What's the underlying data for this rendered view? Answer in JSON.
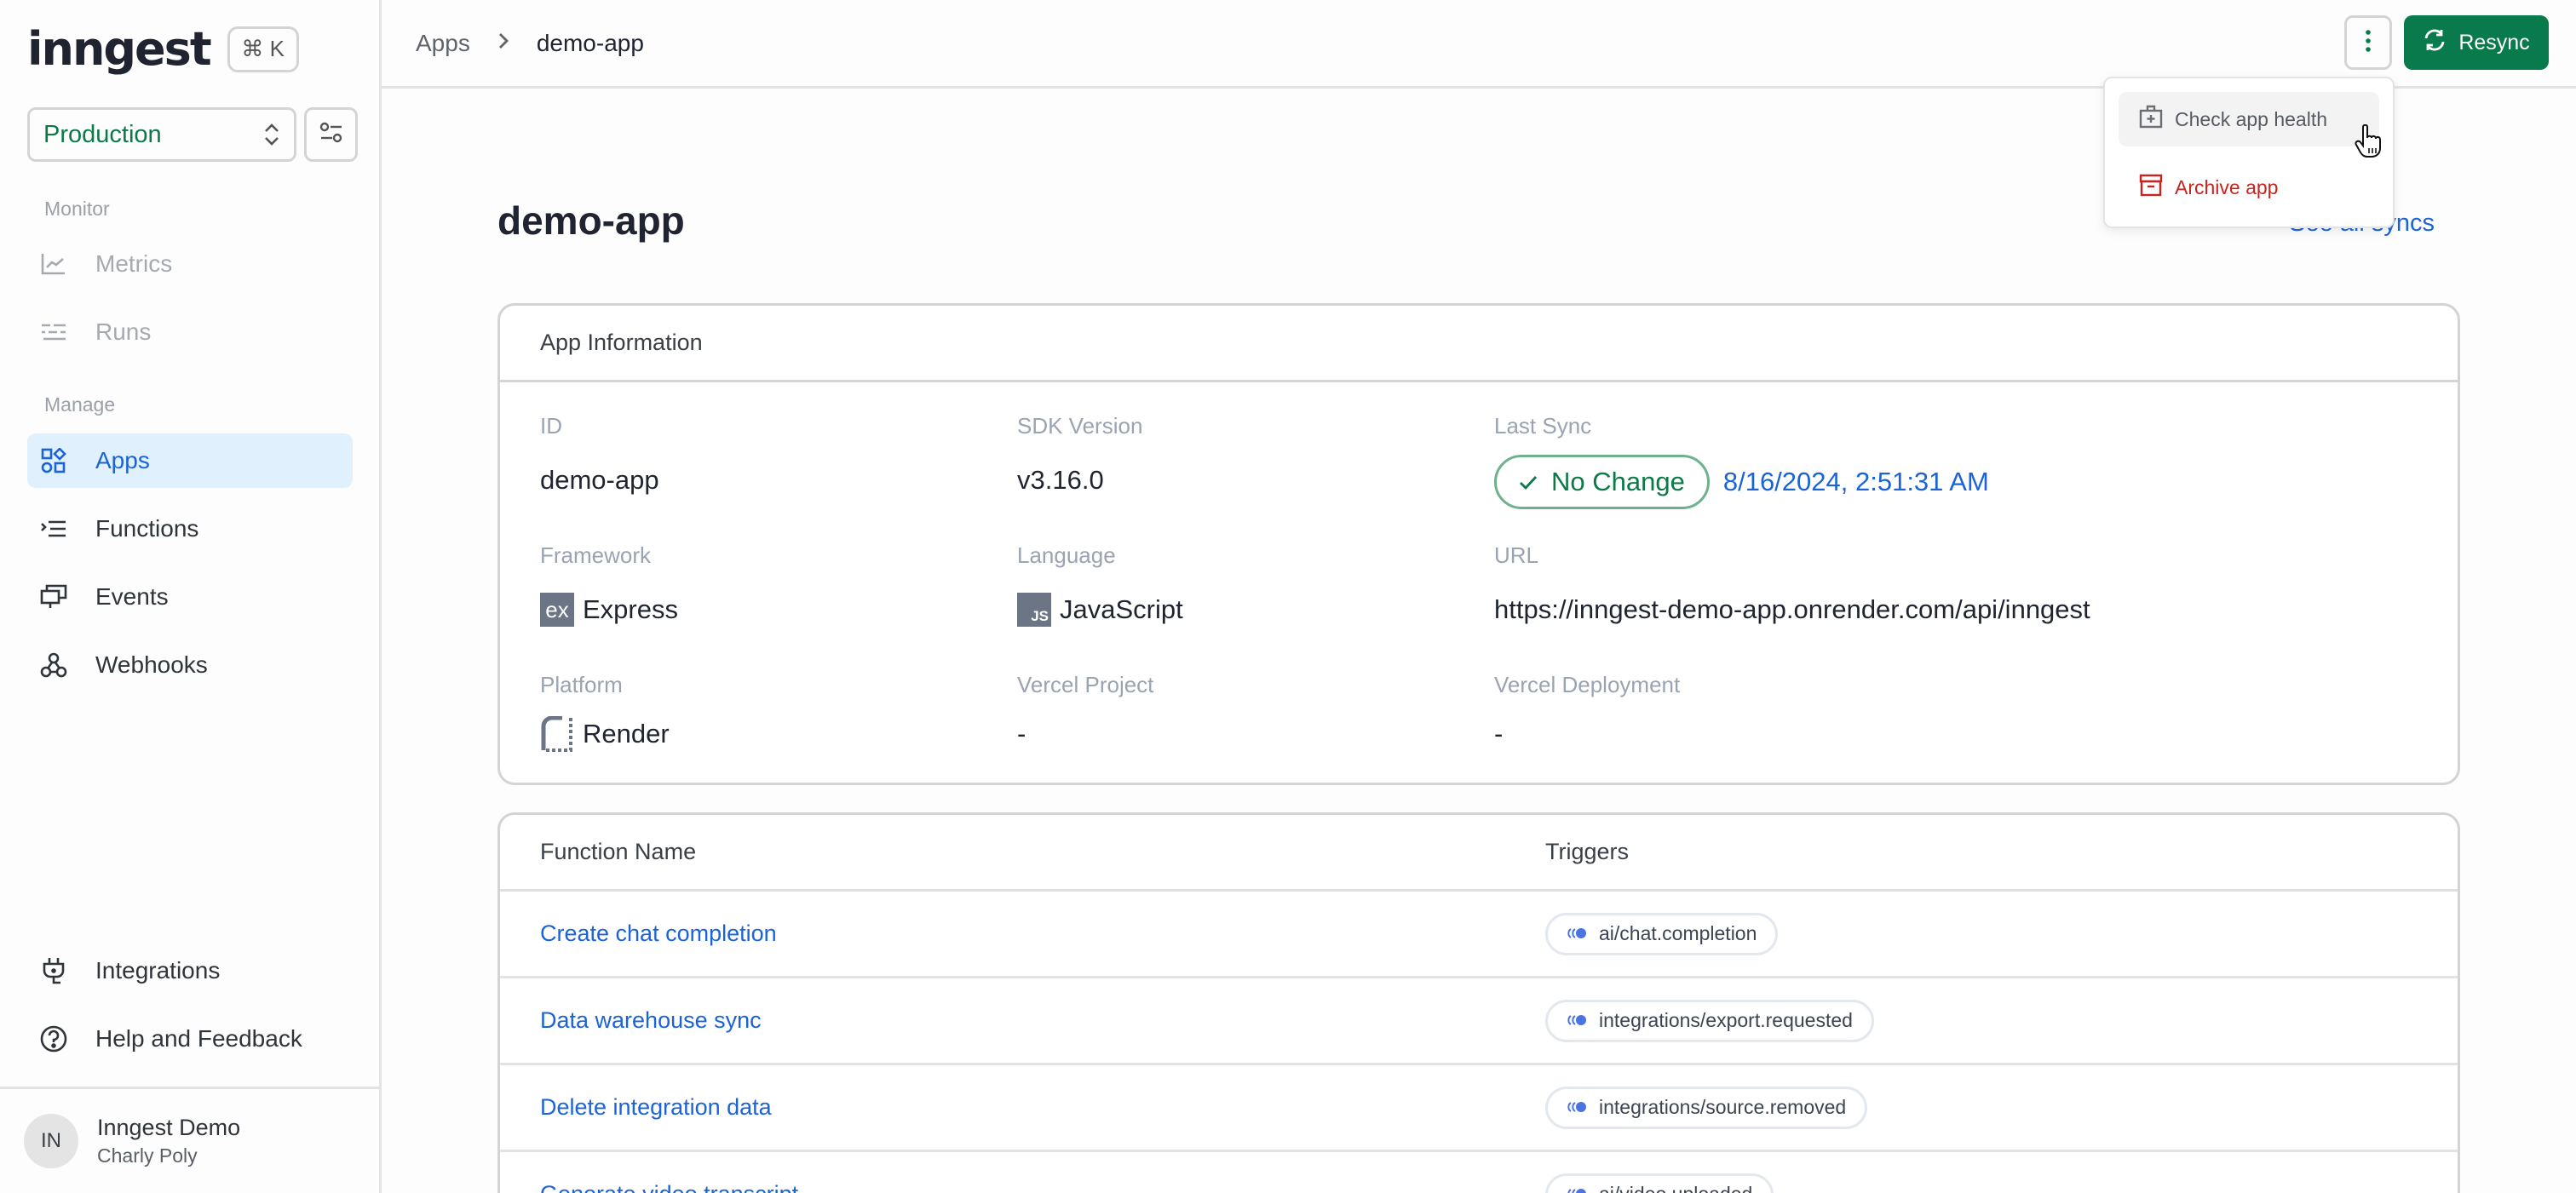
{
  "sidebar": {
    "logo": "inngest",
    "shortcut": "⌘ K",
    "environment": "Production",
    "sections": [
      {
        "label": "Monitor",
        "items": [
          {
            "label": "Metrics",
            "icon": "chart-line-icon",
            "state": "disabled"
          },
          {
            "label": "Runs",
            "icon": "runs-list-icon",
            "state": "disabled"
          }
        ]
      },
      {
        "label": "Manage",
        "items": [
          {
            "label": "Apps",
            "icon": "apps-grid-icon",
            "state": "active"
          },
          {
            "label": "Functions",
            "icon": "functions-icon",
            "state": "normal"
          },
          {
            "label": "Events",
            "icon": "events-icon",
            "state": "normal"
          },
          {
            "label": "Webhooks",
            "icon": "webhook-icon",
            "state": "normal"
          }
        ]
      }
    ],
    "bottom_items": [
      {
        "label": "Integrations",
        "icon": "plug-icon"
      },
      {
        "label": "Help and Feedback",
        "icon": "help-circle-icon"
      }
    ],
    "user": {
      "initials": "IN",
      "org": "Inngest Demo",
      "name": "Charly Poly"
    }
  },
  "topbar": {
    "breadcrumb": [
      "Apps",
      "demo-app"
    ],
    "resync_label": "Resync"
  },
  "dropdown": {
    "items": [
      {
        "label": "Check app health",
        "icon": "first-aid-kit-icon",
        "variant": "default",
        "hovered": true
      },
      {
        "label": "Archive app",
        "icon": "archive-icon",
        "variant": "danger"
      }
    ]
  },
  "page": {
    "title": "demo-app",
    "see_all_syncs": "See all syncs"
  },
  "app_info": {
    "header": "App Information",
    "fields": {
      "id": {
        "label": "ID",
        "value": "demo-app"
      },
      "sdk_version": {
        "label": "SDK Version",
        "value": "v3.16.0"
      },
      "last_sync": {
        "label": "Last Sync",
        "status": "No Change",
        "timestamp": "8/16/2024, 2:51:31 AM"
      },
      "framework": {
        "label": "Framework",
        "value": "Express",
        "icon_text": "ex"
      },
      "language": {
        "label": "Language",
        "value": "JavaScript",
        "icon_text": "JS"
      },
      "url": {
        "label": "URL",
        "value": "https://inngest-demo-app.onrender.com/api/inngest"
      },
      "platform": {
        "label": "Platform",
        "value": "Render"
      },
      "vercel_project": {
        "label": "Vercel Project",
        "value": "-"
      },
      "vercel_deployment": {
        "label": "Vercel Deployment",
        "value": "-"
      }
    }
  },
  "functions": {
    "columns": [
      "Function Name",
      "Triggers"
    ],
    "rows": [
      {
        "name": "Create chat completion",
        "trigger": "ai/chat.completion"
      },
      {
        "name": "Data warehouse sync",
        "trigger": "integrations/export.requested"
      },
      {
        "name": "Delete integration data",
        "trigger": "integrations/source.removed"
      },
      {
        "name": "Generate video transcript",
        "trigger": "ai/video.uploaded"
      }
    ]
  },
  "colors": {
    "brand_green": "#087a4b",
    "link_blue": "#1a63d8",
    "active_bg": "#e1f0fd",
    "danger_red": "#c8241f"
  }
}
